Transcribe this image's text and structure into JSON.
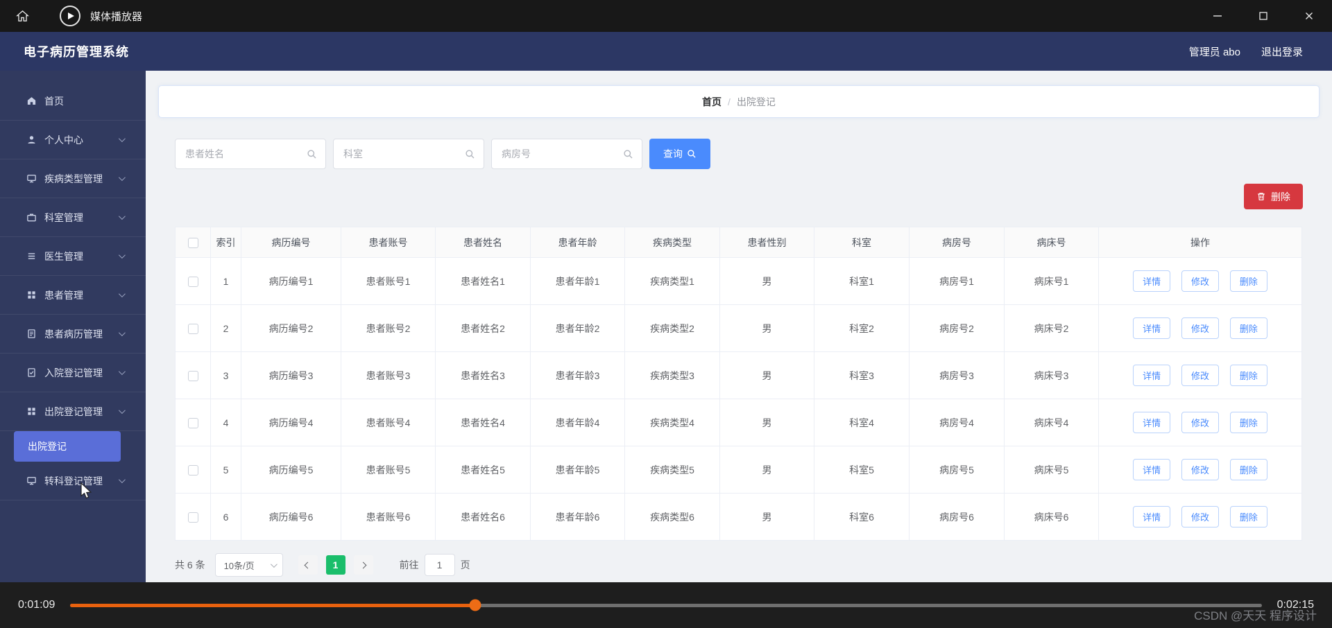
{
  "colors": {
    "header_navy": "#2c3764",
    "sidebar_navy": "#313a5f",
    "active_menu_blue": "#5a6ed8",
    "accent_blue": "#4a8bfd",
    "danger_red": "#d6383f",
    "pagination_green": "#1abe6b",
    "progress_orange": "#e8610e",
    "main_background": "#f0f2f5"
  },
  "window": {
    "app_name": "媒体播放器",
    "controls": [
      "minimize-icon",
      "maximize-icon",
      "close-icon"
    ]
  },
  "header": {
    "title": "电子病历管理系统",
    "user": "管理员 abo",
    "logout": "退出登录"
  },
  "sidebar": {
    "items": [
      {
        "label": "首页",
        "icon": "home-icon",
        "expandable": false
      },
      {
        "label": "个人中心",
        "icon": "user-icon",
        "expandable": true
      },
      {
        "label": "疾病类型管理",
        "icon": "monitor-icon",
        "expandable": true
      },
      {
        "label": "科室管理",
        "icon": "briefcase-icon",
        "expandable": true
      },
      {
        "label": "医生管理",
        "icon": "list-icon",
        "expandable": true
      },
      {
        "label": "患者管理",
        "icon": "grid-icon",
        "expandable": true
      },
      {
        "label": "患者病历管理",
        "icon": "document-icon",
        "expandable": true
      },
      {
        "label": "入院登记管理",
        "icon": "document-check-icon",
        "expandable": true
      },
      {
        "label": "出院登记管理",
        "icon": "grid-icon",
        "expandable": true
      },
      {
        "label": "出院登记",
        "icon": null,
        "active": true
      },
      {
        "label": "转科登记管理",
        "icon": "monitor-icon",
        "expandable": true
      }
    ]
  },
  "breadcrumb": {
    "home": "首页",
    "separator": "/",
    "current": "出院登记"
  },
  "search": {
    "inputs": [
      {
        "placeholder": "患者姓名"
      },
      {
        "placeholder": "科室"
      },
      {
        "placeholder": "病房号"
      }
    ],
    "query": "查询"
  },
  "toolbar": {
    "delete": "删除"
  },
  "table": {
    "headers": [
      "索引",
      "病历编号",
      "患者账号",
      "患者姓名",
      "患者年龄",
      "疾病类型",
      "患者性别",
      "科室",
      "病房号",
      "病床号",
      "操作"
    ],
    "actions": [
      "详情",
      "修改",
      "删除"
    ],
    "rows": [
      {
        "index": "1",
        "record": "病历编号1",
        "account": "患者账号1",
        "name": "患者姓名1",
        "age": "患者年龄1",
        "disease": "疾病类型1",
        "gender": "男",
        "dept": "科室1",
        "room": "病房号1",
        "bed": "病床号1"
      },
      {
        "index": "2",
        "record": "病历编号2",
        "account": "患者账号2",
        "name": "患者姓名2",
        "age": "患者年龄2",
        "disease": "疾病类型2",
        "gender": "男",
        "dept": "科室2",
        "room": "病房号2",
        "bed": "病床号2"
      },
      {
        "index": "3",
        "record": "病历编号3",
        "account": "患者账号3",
        "name": "患者姓名3",
        "age": "患者年龄3",
        "disease": "疾病类型3",
        "gender": "男",
        "dept": "科室3",
        "room": "病房号3",
        "bed": "病床号3"
      },
      {
        "index": "4",
        "record": "病历编号4",
        "account": "患者账号4",
        "name": "患者姓名4",
        "age": "患者年龄4",
        "disease": "疾病类型4",
        "gender": "男",
        "dept": "科室4",
        "room": "病房号4",
        "bed": "病床号4"
      },
      {
        "index": "5",
        "record": "病历编号5",
        "account": "患者账号5",
        "name": "患者姓名5",
        "age": "患者年龄5",
        "disease": "疾病类型5",
        "gender": "男",
        "dept": "科室5",
        "room": "病房号5",
        "bed": "病床号5"
      },
      {
        "index": "6",
        "record": "病历编号6",
        "account": "患者账号6",
        "name": "患者姓名6",
        "age": "患者年龄6",
        "disease": "疾病类型6",
        "gender": "男",
        "dept": "科室6",
        "room": "病房号6",
        "bed": "病床号6"
      }
    ]
  },
  "pagination": {
    "total": "共 6 条",
    "page_size": "10条/页",
    "page": "1",
    "goto_label": "前往",
    "goto_value": "1",
    "goto_unit": "页"
  },
  "player": {
    "elapsed": "0:01:09",
    "duration": "0:02:15",
    "progress_percent": 34
  },
  "watermark": "CSDN @天天 程序设计"
}
